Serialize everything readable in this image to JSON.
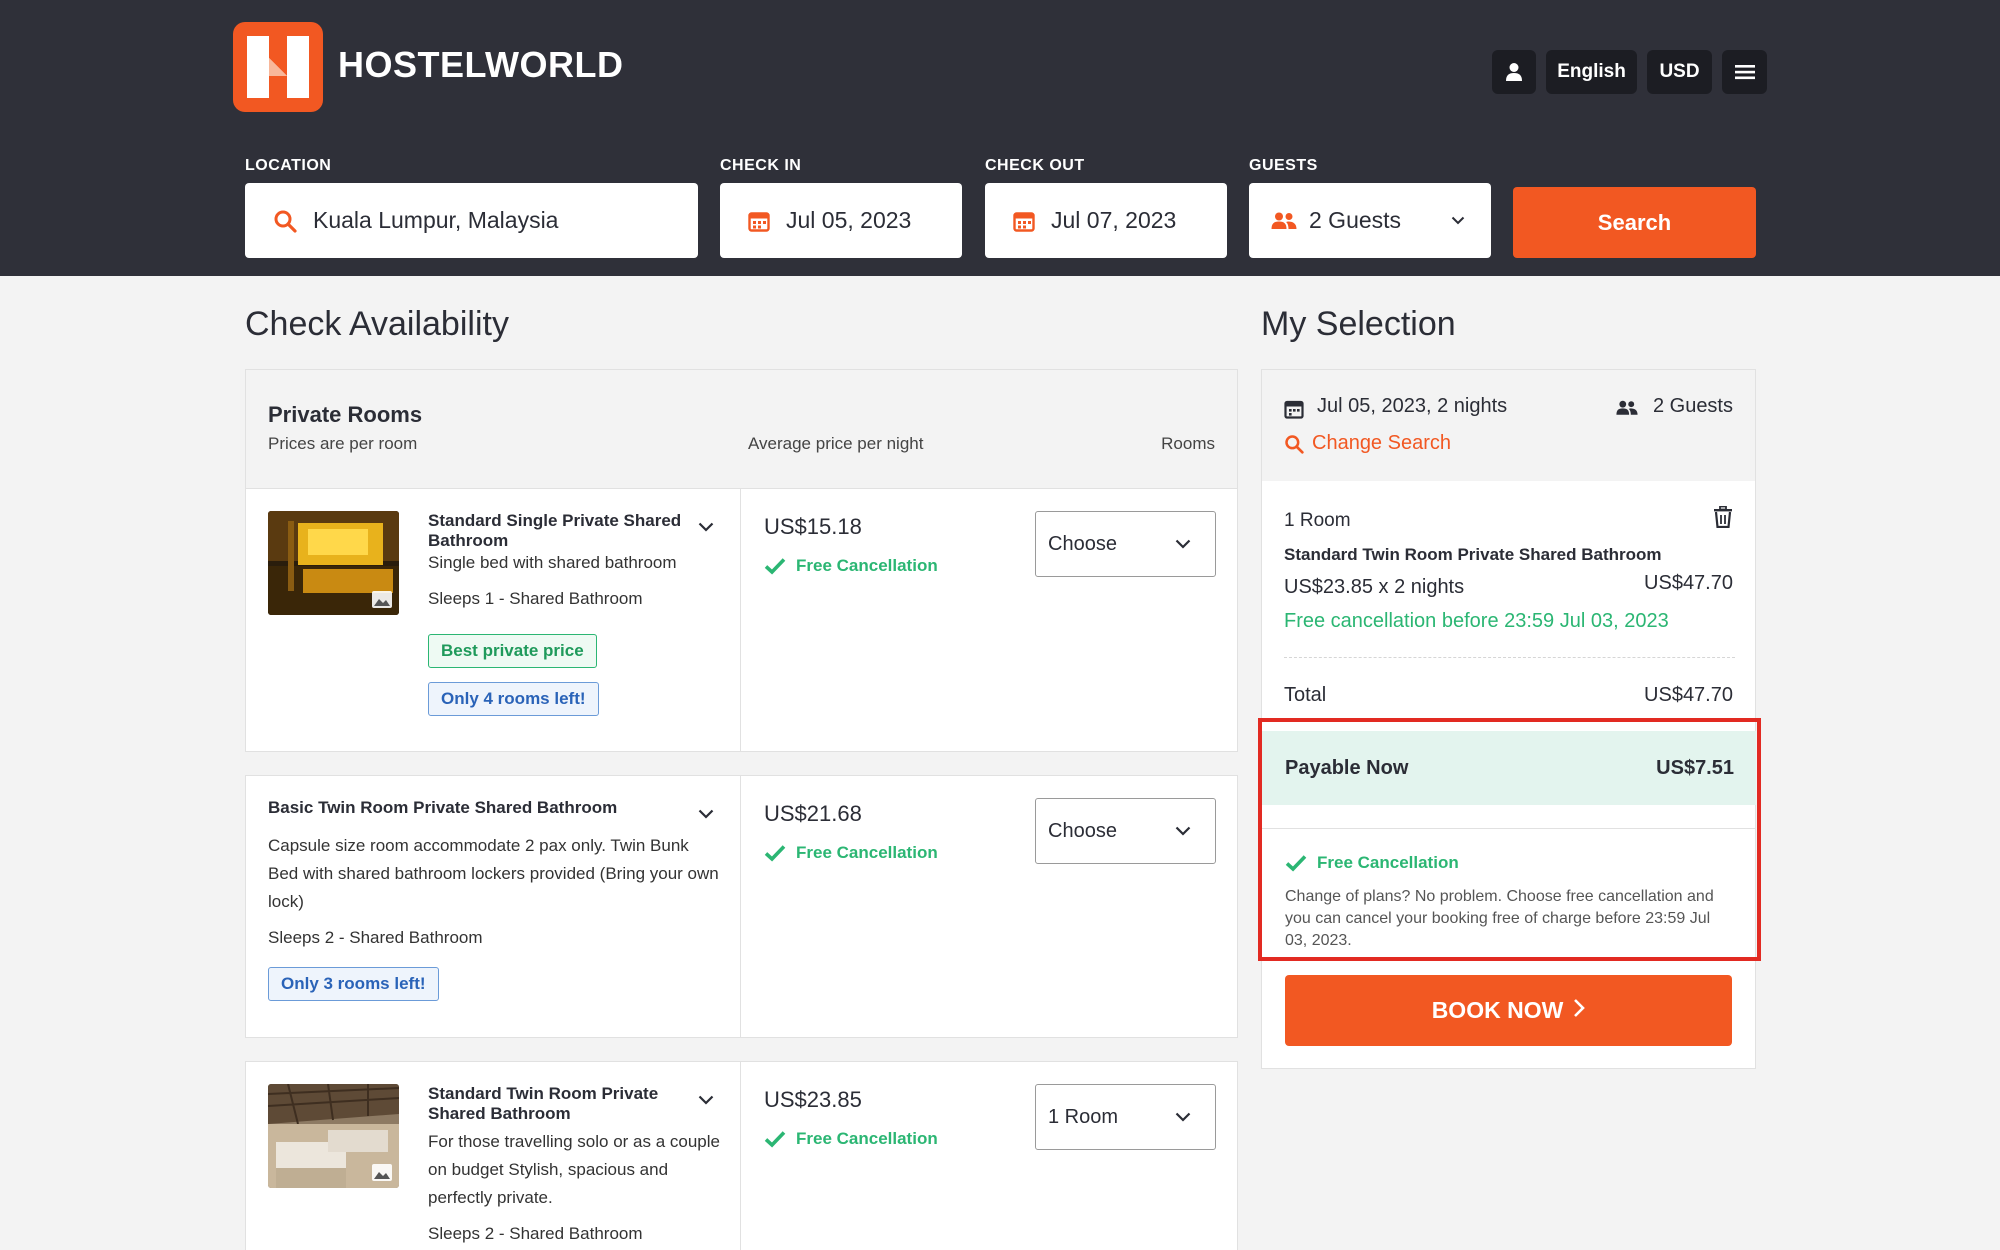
{
  "brand": {
    "name": "HOSTELWORLD"
  },
  "nav": {
    "language": "English",
    "currency": "USD"
  },
  "search": {
    "location_label": "LOCATION",
    "location_value": "Kuala Lumpur, Malaysia",
    "checkin_label": "CHECK IN",
    "checkin_value": "Jul 05, 2023",
    "checkout_label": "CHECK OUT",
    "checkout_value": "Jul 07, 2023",
    "guests_label": "GUESTS",
    "guests_value": "2 Guests",
    "button_label": "Search"
  },
  "availability": {
    "heading": "Check Availability",
    "section_title": "Private Rooms",
    "section_subtitle": "Prices are per room",
    "col_price": "Average price per night",
    "col_rooms": "Rooms",
    "rooms": [
      {
        "title": "Standard Single Private Shared Bathroom",
        "description": "Single bed with shared bathroom",
        "sleeps": "Sleeps 1 - Shared Bathroom",
        "badge_best": "Best private price",
        "badge_left": "Only 4 rooms left!",
        "price": "US$15.18",
        "cancellation": "Free Cancellation",
        "selection": "Choose"
      },
      {
        "title": "Basic Twin Room Private Shared Bathroom",
        "description": "Capsule size room accommodate 2 pax only. Twin Bunk Bed with shared bathroom lockers provided (Bring your own lock)",
        "sleeps": "Sleeps 2 - Shared Bathroom",
        "badge_left": "Only 3 rooms left!",
        "price": "US$21.68",
        "cancellation": "Free Cancellation",
        "selection": "Choose"
      },
      {
        "title": "Standard Twin Room Private Shared Bathroom",
        "description": "For those travelling solo or as a couple on budget Stylish, spacious and perfectly private.",
        "sleeps": "Sleeps 2 - Shared Bathroom",
        "price": "US$23.85",
        "cancellation": "Free Cancellation",
        "selection": "1 Room"
      }
    ]
  },
  "selection": {
    "heading": "My Selection",
    "dates": "Jul 05, 2023, 2 nights",
    "guests": "2 Guests",
    "change_search": "Change Search",
    "room_count": "1 Room",
    "room_name": "Standard Twin Room Private Shared Bathroom",
    "price_calc": "US$23.85 x 2 nights",
    "price_total_line": "US$47.70",
    "free_cancel_before": "Free cancellation before 23:59 Jul 03, 2023",
    "total_label": "Total",
    "total_value": "US$47.70",
    "payable_label": "Payable Now",
    "payable_value": "US$7.51",
    "fc_title": "Free Cancellation",
    "fc_text": "Change of plans? No problem. Choose free cancellation and you can cancel your booking free of charge before 23:59 Jul 03, 2023.",
    "book_label": "BOOK NOW"
  },
  "colors": {
    "brand_orange": "#f25822",
    "header_bg": "#2f3039",
    "success_green": "#2bb673",
    "highlight_red": "#e22a22"
  }
}
